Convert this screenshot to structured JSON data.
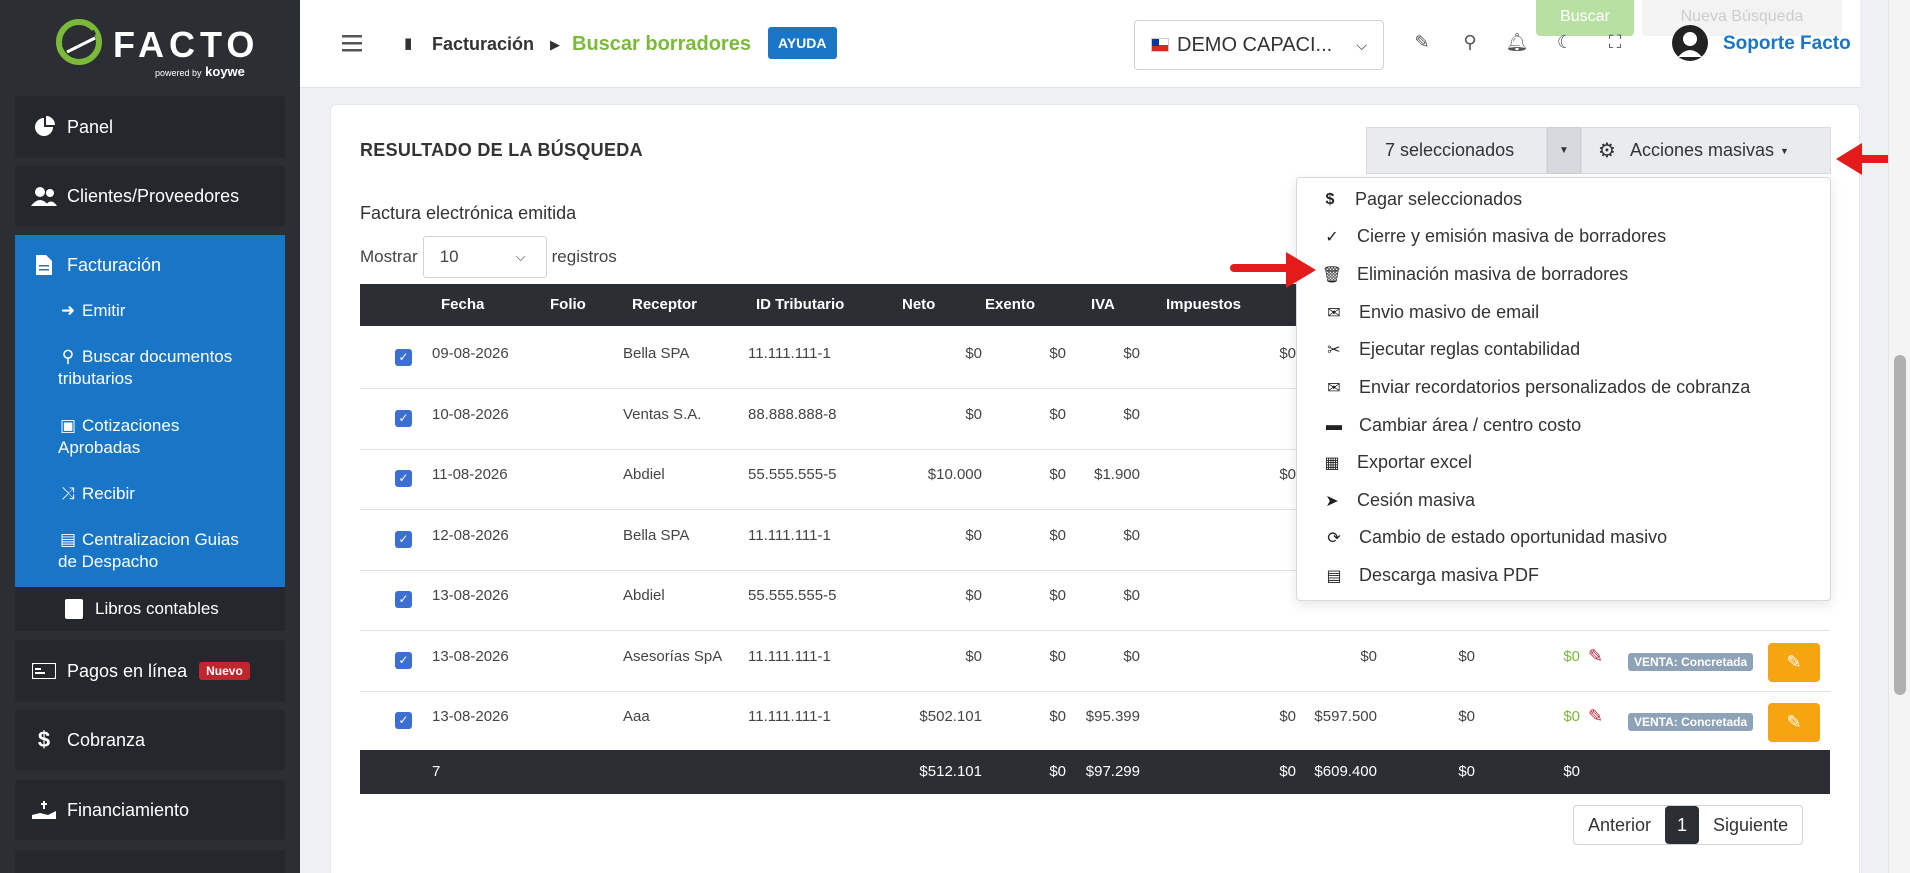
{
  "brand": {
    "name": "FACTO",
    "powered": "powered by",
    "by": "koywe"
  },
  "sidebar": {
    "items": [
      {
        "label": "Panel",
        "icon": "pie-chart-icon"
      },
      {
        "label": "Clientes/Proveedores",
        "icon": "users-icon"
      },
      {
        "label": "Facturación",
        "icon": "document-icon"
      },
      {
        "label": "Pagos en línea",
        "icon": "card-icon",
        "badge": "Nuevo"
      },
      {
        "label": "Cobranza",
        "icon": "dollar-icon"
      },
      {
        "label": "Financiamiento",
        "icon": "hand-dollar-icon"
      }
    ],
    "sub_items": [
      {
        "label": "Emitir",
        "icon": "sign-in-icon"
      },
      {
        "label": "Buscar documentos tributarios",
        "icon": "search-icon"
      },
      {
        "label": "Cotizaciones Aprobadas",
        "icon": "briefcase-icon"
      },
      {
        "label": "Recibir",
        "icon": "shuffle-icon"
      },
      {
        "label": "Centralizacion Guias de Despacho",
        "icon": "file-icon"
      }
    ],
    "libros": "Libros contables"
  },
  "header": {
    "breadcrumb_root": "Facturación",
    "breadcrumb_current": "Buscar borradores",
    "help": "AYUDA",
    "company": "DEMO CAPACI...",
    "user": "Soporte Facto",
    "top_dim_left": "Buscar",
    "top_dim_right": "Nueva Búsqueda"
  },
  "card": {
    "title": "RESULTADO DE LA BÚSQUEDA",
    "selected": "7 seleccionados",
    "mass_actions": "Acciones masivas",
    "subtitle": "Factura electrónica emitida",
    "show_label": "Mostrar",
    "show_value": "10",
    "records_label": "registros"
  },
  "table": {
    "headers": [
      "Fecha",
      "Folio",
      "Receptor",
      "ID Tributario",
      "Neto",
      "Exento",
      "IVA",
      "Impuestos"
    ],
    "rows": [
      {
        "fecha": "09-08-2026",
        "receptor": "Bella SPA",
        "id": "11.111.111-1",
        "neto": "$0",
        "exento": "$0",
        "iva": "$0",
        "imp": "$0",
        "total": "",
        "c10": "",
        "c11": "",
        "estado": ""
      },
      {
        "fecha": "10-08-2026",
        "receptor": "Ventas S.A.",
        "id": "88.888.888-8",
        "neto": "$0",
        "exento": "$0",
        "iva": "$0",
        "imp": "",
        "total": "",
        "c10": "",
        "c11": "",
        "estado": ""
      },
      {
        "fecha": "11-08-2026",
        "receptor": "Abdiel",
        "id": "55.555.555-5",
        "neto": "$10.000",
        "exento": "$0",
        "iva": "$1.900",
        "imp": "$0",
        "total": "",
        "c10": "",
        "c11": "",
        "estado": ""
      },
      {
        "fecha": "12-08-2026",
        "receptor": "Bella SPA",
        "id": "11.111.111-1",
        "neto": "$0",
        "exento": "$0",
        "iva": "$0",
        "imp": "",
        "total": "",
        "c10": "",
        "c11": "",
        "estado": ""
      },
      {
        "fecha": "13-08-2026",
        "receptor": "Abdiel",
        "id": "55.555.555-5",
        "neto": "$0",
        "exento": "$0",
        "iva": "$0",
        "imp": "",
        "total": "",
        "c10": "",
        "c11": "",
        "estado": ""
      },
      {
        "fecha": "13-08-2026",
        "receptor": "Asesorías SpA",
        "id": "11.111.111-1",
        "neto": "$0",
        "exento": "$0",
        "iva": "$0",
        "imp": "",
        "total": "$0",
        "c10": "$0",
        "c11": "$0",
        "estado": "VENTA: Concretada"
      },
      {
        "fecha": "13-08-2026",
        "receptor": "Aaa",
        "id": "11.111.111-1",
        "neto": "$502.101",
        "exento": "$0",
        "iva": "$95.399",
        "imp": "$0",
        "total": "$597.500",
        "c10": "$0",
        "c11": "$0",
        "estado": "VENTA: Concretada"
      }
    ],
    "footer": {
      "count": "7",
      "neto": "$512.101",
      "exento": "$0",
      "iva": "$97.299",
      "imp": "$0",
      "total": "$609.400",
      "c10": "$0",
      "c11": "$0"
    }
  },
  "dropdown": {
    "items": [
      {
        "label": "Pagar seleccionados",
        "icon": "dollar-icon"
      },
      {
        "label": "Cierre y emisión masiva de borradores",
        "icon": "check-icon"
      },
      {
        "label": "Eliminación masiva de borradores",
        "icon": "trash-icon"
      },
      {
        "label": "Envio masivo de email",
        "icon": "envelope-icon"
      },
      {
        "label": "Ejecutar reglas contabilidad",
        "icon": "tools-icon"
      },
      {
        "label": "Enviar recordatorios personalizados de cobranza",
        "icon": "envelope-icon"
      },
      {
        "label": "Cambiar área / centro costo",
        "icon": "archive-icon"
      },
      {
        "label": "Exportar excel",
        "icon": "excel-icon"
      },
      {
        "label": "Cesión masiva",
        "icon": "send-icon"
      },
      {
        "label": "Cambio de estado oportunidad masivo",
        "icon": "refresh-icon"
      },
      {
        "label": "Descarga masiva PDF",
        "icon": "pdf-icon"
      }
    ]
  },
  "pagination": {
    "prev": "Anterior",
    "current": "1",
    "next": "Siguiente"
  },
  "colors": {
    "sidebar": "#2b2e33",
    "accent": "#1976c7",
    "green": "#7bb93b",
    "orange": "#f6a40f",
    "red_arrow": "#e31b1b"
  }
}
